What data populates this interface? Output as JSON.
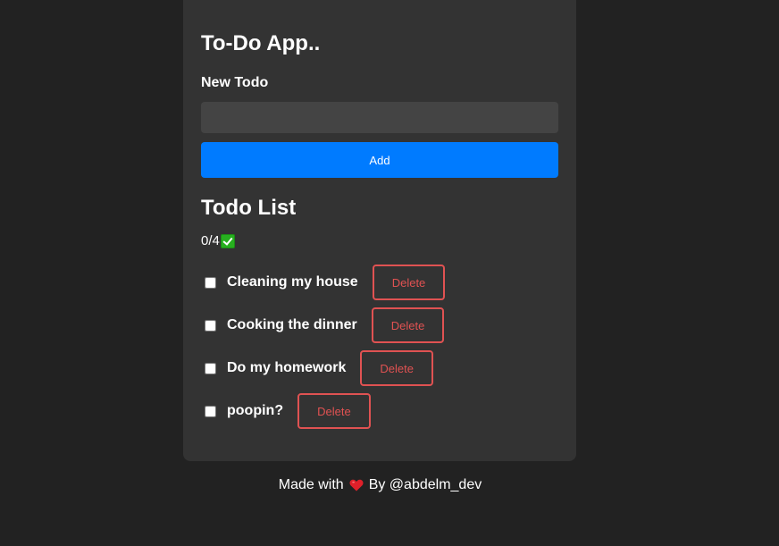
{
  "app": {
    "title": "To-Do App.."
  },
  "form": {
    "label": "New Todo",
    "input_value": "",
    "input_placeholder": "",
    "add_label": "Add"
  },
  "list": {
    "title": "Todo List",
    "counter": "0/4",
    "counter_icon": "check-mark-button-icon",
    "items": [
      {
        "text": "Cleaning my house",
        "done": false,
        "delete_label": "Delete"
      },
      {
        "text": "Cooking the dinner",
        "done": false,
        "delete_label": "Delete"
      },
      {
        "text": "Do my homework",
        "done": false,
        "delete_label": "Delete"
      },
      {
        "text": "poopin?",
        "done": false,
        "delete_label": "Delete"
      }
    ]
  },
  "footer": {
    "made_with": "Made with",
    "heart_icon": "red-heart-icon",
    "by": "By @abdelm_dev"
  },
  "colors": {
    "background": "#222222",
    "card": "#333333",
    "input": "#444444",
    "accent": "#007bff",
    "danger": "#e05252"
  }
}
